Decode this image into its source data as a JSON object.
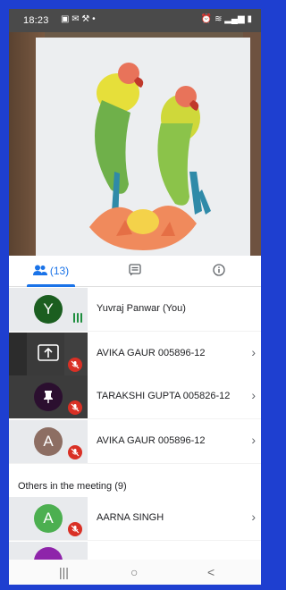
{
  "status_bar": {
    "time": "18:23",
    "left_icons": [
      "gallery-icon",
      "mail-icon",
      "tool-icon",
      "dot-icon"
    ],
    "right_icons": [
      "alarm-icon",
      "wifi-icon",
      "signal-icon",
      "battery-icon"
    ]
  },
  "tabs": [
    {
      "label": "(13)",
      "icon": "people-icon",
      "active": true
    },
    {
      "label": "",
      "icon": "chat-icon",
      "active": false
    },
    {
      "label": "",
      "icon": "info-icon",
      "active": false
    }
  ],
  "participants": [
    {
      "name": "Yuvraj Panwar (You)",
      "avatar_letter": "Y",
      "avatar_color": "#1b5e20",
      "thumb_color": "#e8eaed",
      "status": "speaking"
    },
    {
      "name": "AVIKA GAUR 005896-12",
      "avatar_letter": "",
      "avatar_color": "",
      "thumb_color": "#3a3a3a",
      "status": "presenting-muted"
    },
    {
      "name": "TARAKSHI GUPTA 005826-12",
      "avatar_letter": "",
      "avatar_color": "#2b0f2f",
      "thumb_color": "#3c3c3c",
      "status": "pinned-muted"
    },
    {
      "name": "AVIKA GAUR 005896-12",
      "avatar_letter": "A",
      "avatar_color": "#8d6e63",
      "thumb_color": "#e8eaed",
      "status": "muted"
    }
  ],
  "others_title": "Others in the meeting (9)",
  "others": [
    {
      "name": "AARNA SINGH",
      "avatar_letter": "A",
      "avatar_color": "#4caf50",
      "thumb_color": "#e8eaed",
      "status": "muted"
    },
    {
      "name": "",
      "avatar_letter": "",
      "avatar_color": "#8e24aa",
      "thumb_color": "#e8eaed",
      "status": "partial"
    }
  ],
  "nav": {
    "recent": "|||",
    "home": "○",
    "back": "<"
  }
}
